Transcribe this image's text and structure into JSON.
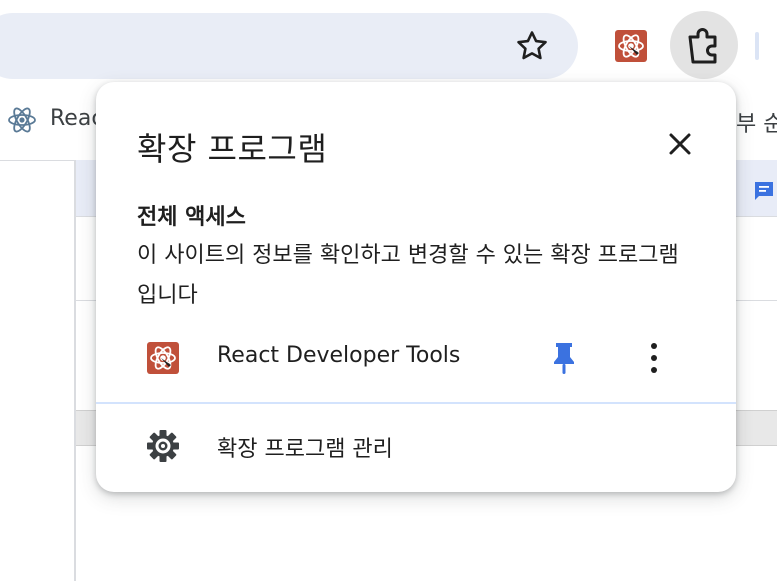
{
  "toolbar": {
    "bookmark_star_icon": "star-outline-icon",
    "react_extension_icon": "react-devtools-icon",
    "extensions_icon": "puzzle-icon"
  },
  "bookmarks": {
    "items": [
      {
        "label": "Reac",
        "icon": "react-atom-icon"
      },
      {
        "label": "부 순",
        "icon": ""
      }
    ]
  },
  "popup": {
    "title": "확장 프로그램",
    "close_icon": "close-icon",
    "access_heading": "전체 액세스",
    "access_description": "이 사이트의 정보를 확인하고 변경할 수 있는 확장 프로그램입니다",
    "extensions": [
      {
        "name": "React Developer Tools",
        "icon": "react-devtools-icon",
        "pinned": true,
        "pin_icon": "pin-icon",
        "more_icon": "more-vert-icon"
      }
    ],
    "manage_label": "확장 프로그램 관리",
    "manage_icon": "gear-icon"
  },
  "colors": {
    "omnibox": "#e9edf6",
    "pin_accent": "#3b72e0",
    "extension_icon_bg": "#c0503a",
    "divider": "#d3e3fd"
  }
}
